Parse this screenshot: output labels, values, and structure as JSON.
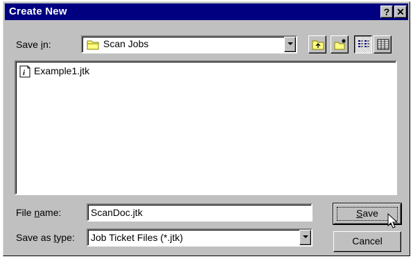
{
  "dialog": {
    "title": "Create New",
    "help_button": "?",
    "close_button": "✕"
  },
  "save_in": {
    "label_prefix": "Save ",
    "label_access": "i",
    "label_suffix": "n:",
    "value": "Scan Jobs"
  },
  "toolbar": {
    "up_one_level": "up-folder-icon",
    "create_new_folder": "new-folder-icon",
    "list_view": "list-view-icon",
    "details_view": "details-view-icon"
  },
  "files": [
    {
      "name": "Example1.jtk",
      "icon": "job-ticket-file-icon"
    }
  ],
  "file_name": {
    "label_prefix": "File ",
    "label_access": "n",
    "label_suffix": "ame:",
    "value": "ScanDoc.jtk"
  },
  "save_as_type": {
    "label_prefix": "Save as ",
    "label_access": "t",
    "label_suffix": "ype:",
    "value": "Job Ticket Files (*.jtk)"
  },
  "buttons": {
    "save_access": "S",
    "save_rest": "ave",
    "cancel": "Cancel"
  }
}
